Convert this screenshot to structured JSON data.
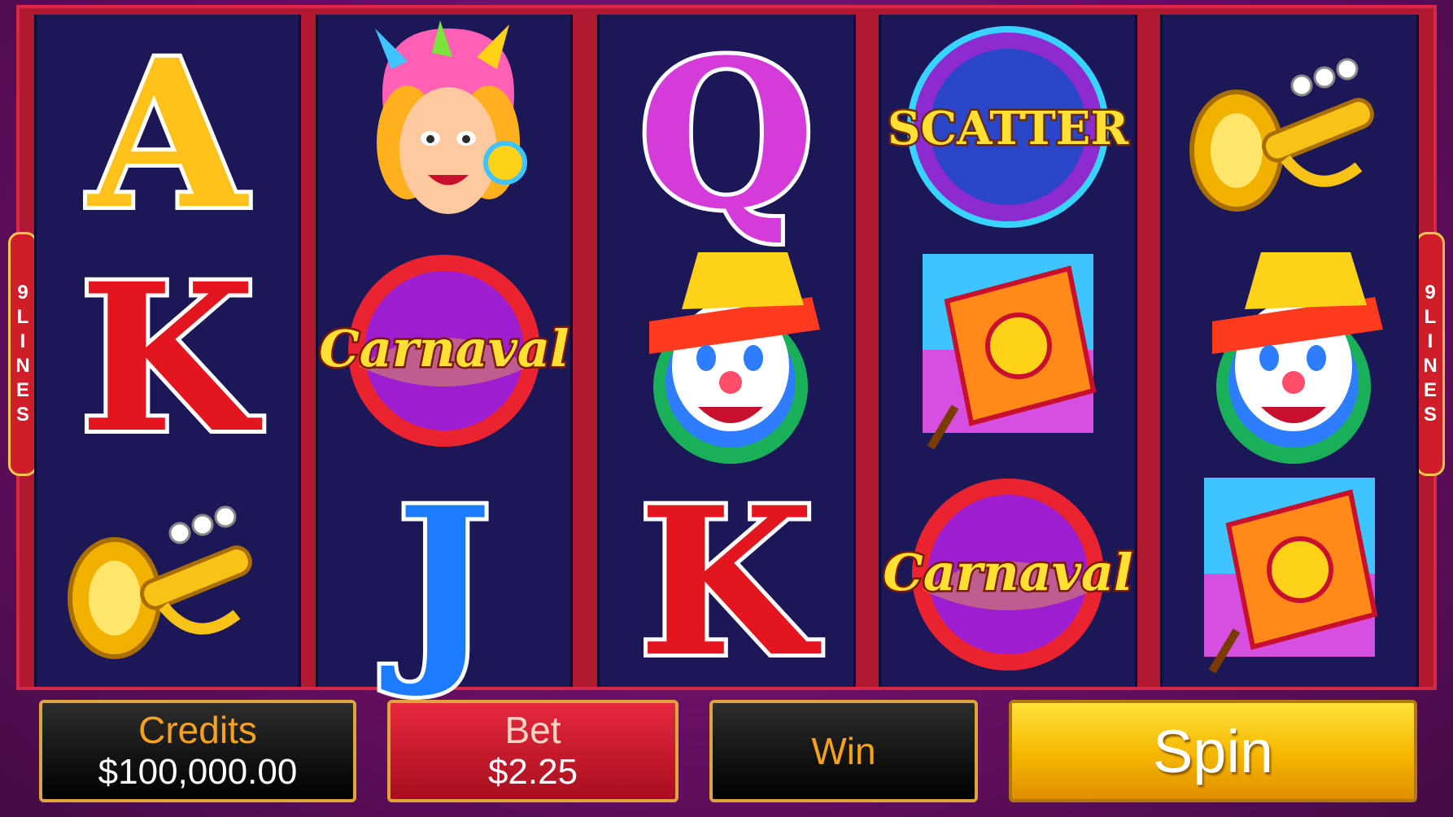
{
  "game": {
    "reels": [
      [
        "A",
        "K",
        "trumpet"
      ],
      [
        "carnival-dancer",
        "Carnaval",
        "J"
      ],
      [
        "Q",
        "clown",
        "K"
      ],
      [
        "SCATTER",
        "sun-banner",
        "Carnaval"
      ],
      [
        "trumpet",
        "clown",
        "sun-banner"
      ]
    ],
    "letter_symbols": {
      "A": "A",
      "K": "K",
      "Q": "Q",
      "J": "J"
    },
    "logo_text": "Carnaval",
    "scatter_text": "SCATTER",
    "lines_number": "9",
    "lines_text": "LINES"
  },
  "controls": {
    "credits_label": "Credits",
    "credits_value": "$100,000.00",
    "bet_label": "Bet",
    "bet_value": "$2.25",
    "win_label": "Win",
    "win_value": "",
    "spin_label": "Spin"
  },
  "colors": {
    "background": "#7a1370",
    "reel_bg": "#1c1757",
    "frame": "#b0192f",
    "accent_gold": "#f6a21c",
    "spin_yellow": "#ffd21a"
  }
}
